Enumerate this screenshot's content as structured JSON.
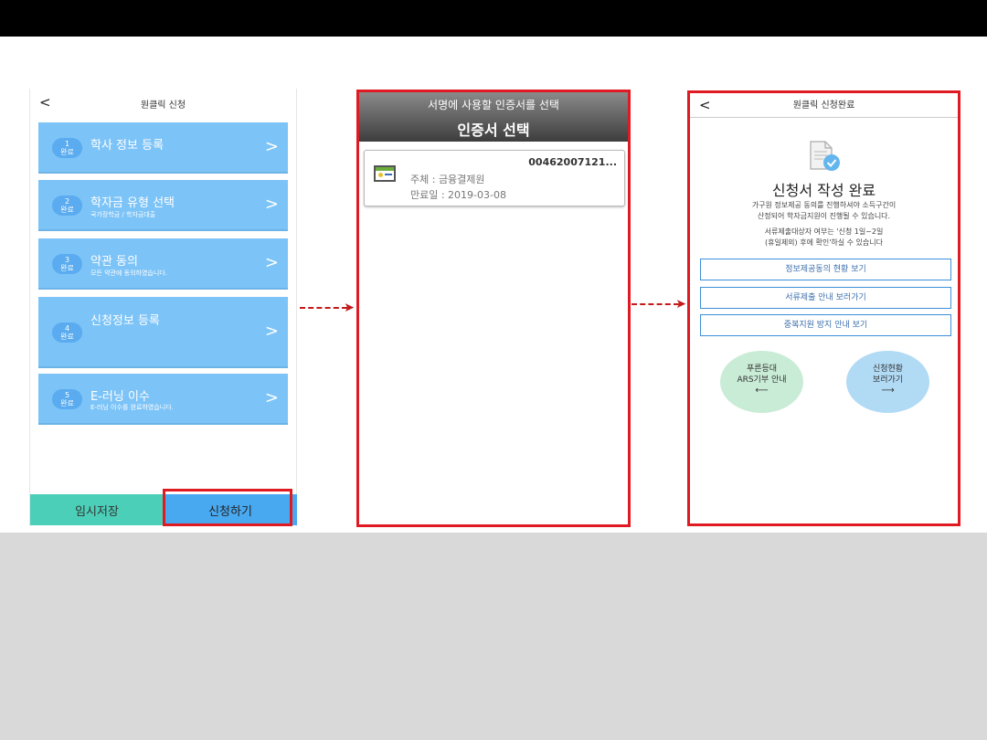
{
  "phone1": {
    "header_title": "원클릭 신청",
    "back_label": "<",
    "steps": [
      {
        "badge_num": "1",
        "badge_label": "완료",
        "title": "학사 정보 등록",
        "subtitle": ""
      },
      {
        "badge_num": "2",
        "badge_label": "완료",
        "title": "학자금 유형 선택",
        "subtitle": "국가장학금 / 학자금대출"
      },
      {
        "badge_num": "3",
        "badge_label": "완료",
        "title": "약관 동의",
        "subtitle": "모든 약관에 동의하였습니다."
      },
      {
        "badge_num": "4",
        "badge_label": "완료",
        "title": "신청정보 등록",
        "subtitle": ""
      },
      {
        "badge_num": "5",
        "badge_label": "완료",
        "title": "E-러닝 이수",
        "subtitle": "E-러닝 이수를 완료하였습니다."
      }
    ],
    "chevron": ">",
    "btn_temp_save": "임시저장",
    "btn_apply": "신청하기"
  },
  "phone2": {
    "subtitle": "서명에 사용할 인증서를 선택",
    "title": "인증서 선택",
    "cert": {
      "serial": "00462007121...",
      "subject": "주체 : 금융결제원",
      "expiry": "만료일 : 2019-03-08"
    }
  },
  "phone3": {
    "header_title": "원클릭 신청완료",
    "back_label": "<",
    "done_title": "신청서 작성 완료",
    "desc_line1": "가구원 정보제공 동의를 진행하셔야 소득구간이",
    "desc_line2": "산정되어 학자금지원이 진행될 수 있습니다.",
    "note_line1": "서류제출대상자 여부는 '신청 1일~2일",
    "note_line2": "(휴일제외) 후에 확인'하실 수 있습니다",
    "buttons": [
      "정보제공동의 현황 보기",
      "서류제출 안내 보러가기",
      "중복지원 방지 안내 보기"
    ],
    "circle_left": {
      "line1": "푸른등대",
      "line2": "ARS기부 안내",
      "arrow": "⟵"
    },
    "circle_right": {
      "line1": "신청현황",
      "line2": "보러가기",
      "arrow": "⟶"
    }
  },
  "colors": {
    "step_bg": "#7cc3f7",
    "highlight": "#e01a22",
    "arrow": "#c21b1b",
    "temp_btn": "#4ccfb8",
    "apply_btn": "#49a9f0"
  }
}
